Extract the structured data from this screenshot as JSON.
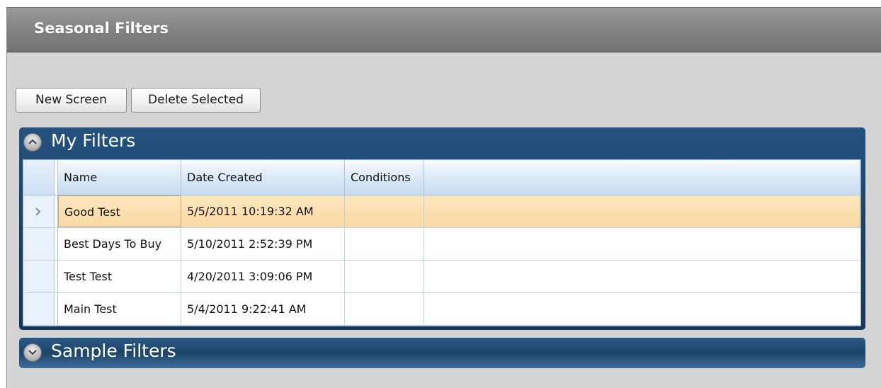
{
  "window": {
    "title": "Seasonal Filters"
  },
  "toolbar": {
    "new_label": "New Screen",
    "delete_label": "Delete Selected"
  },
  "panels": {
    "my_filters": {
      "title": "My Filters",
      "columns": [
        "Name",
        "Date Created",
        "Conditions"
      ],
      "rows": [
        {
          "name": "Good Test",
          "date": "5/5/2011 10:19:32 AM",
          "conditions": ""
        },
        {
          "name": "Best Days To Buy",
          "date": "5/10/2011 2:52:39 PM",
          "conditions": ""
        },
        {
          "name": "Test Test",
          "date": "4/20/2011 3:09:06 PM",
          "conditions": ""
        },
        {
          "name": "Main Test",
          "date": "5/4/2011 9:22:41 AM",
          "conditions": ""
        }
      ],
      "selected_row": 0
    },
    "sample_filters": {
      "title": "Sample Filters"
    }
  },
  "icons": {
    "collapse": "chevron-up-icon",
    "expand": "chevron-down-icon",
    "row_indicator": "chevron-right-icon"
  },
  "colors": {
    "accent": "#1b3f62",
    "selection": "#fad9a3",
    "titlebar": "#858585"
  }
}
